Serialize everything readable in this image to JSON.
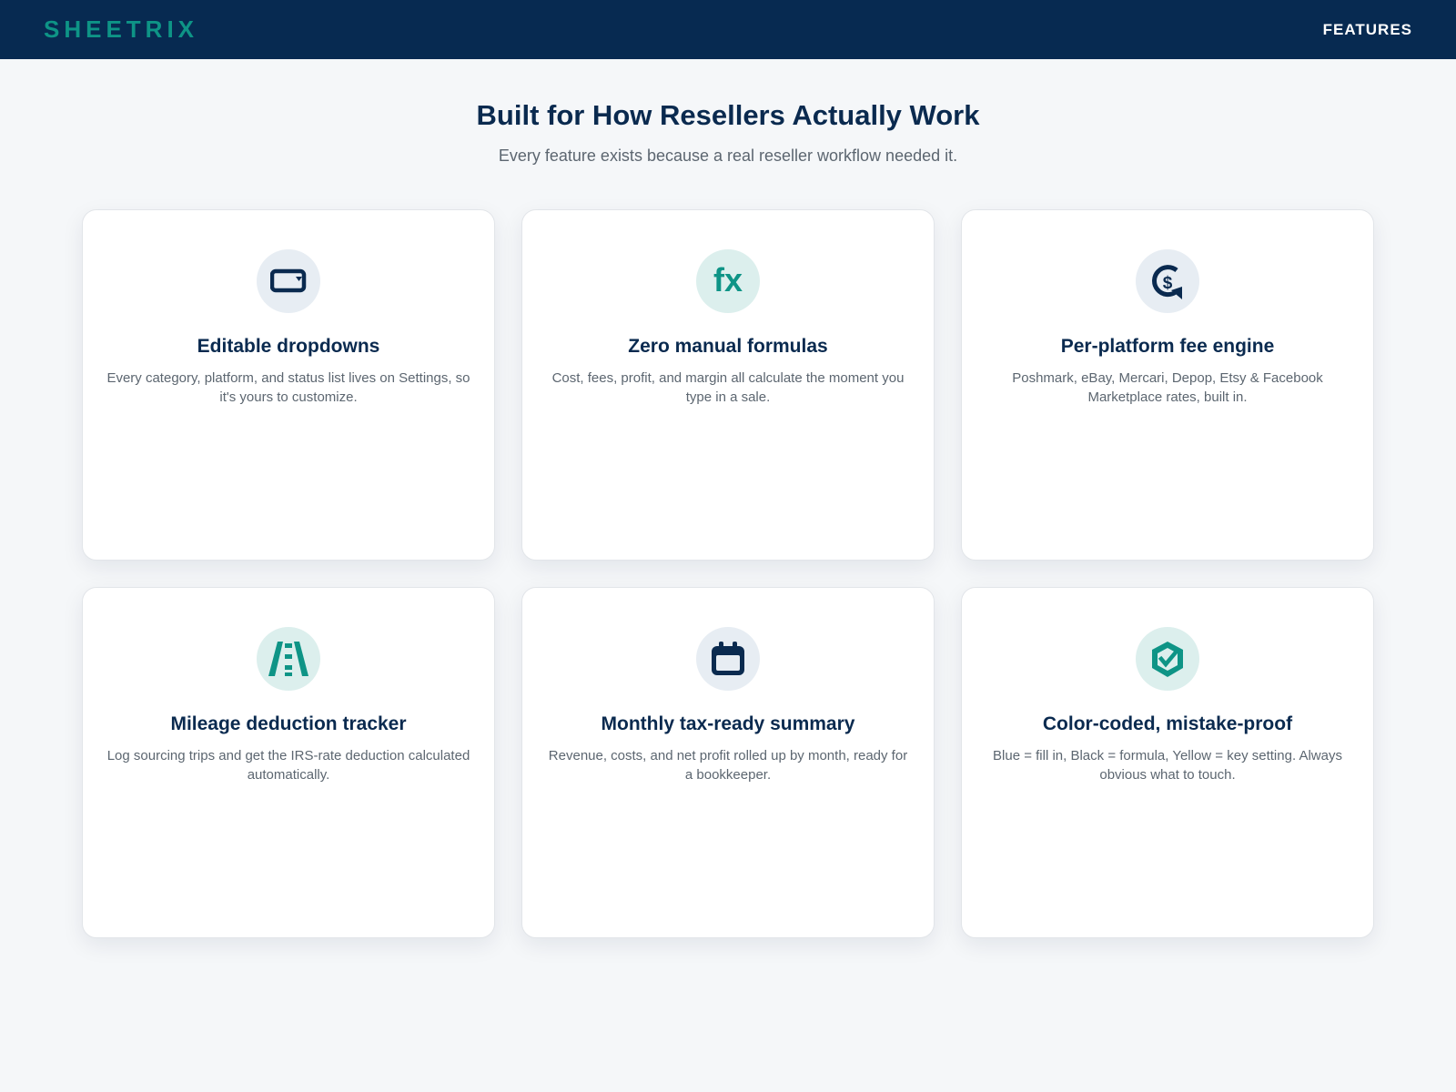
{
  "header": {
    "logo": "SHEETRIX",
    "nav_link": "FEATURES"
  },
  "hero": {
    "title": "Built for How Resellers Actually Work",
    "subtitle": "Every feature exists because a real reseller workflow needed it."
  },
  "colors": {
    "navy": "#072a51",
    "teal": "#0e9486",
    "background": "#f5f7f9"
  },
  "features": [
    {
      "icon": "dropdown-icon",
      "glyph": "",
      "title": "Editable dropdowns",
      "description": "Every category, platform, and status list lives on Settings, so it's yours to customize."
    },
    {
      "icon": "formula-icon",
      "glyph": "fx",
      "title": "Zero manual formulas",
      "description": "Cost, fees, profit, and margin all calculate the moment you type in a sale."
    },
    {
      "icon": "dollar-cycle-icon",
      "glyph": "",
      "title": "Per-platform fee engine",
      "description": "Poshmark, eBay, Mercari, Depop, Etsy & Facebook Marketplace rates, built in."
    },
    {
      "icon": "road-icon",
      "glyph": "",
      "title": "Mileage deduction tracker",
      "description": "Log sourcing trips and get the IRS-rate deduction calculated automatically."
    },
    {
      "icon": "calendar-icon",
      "glyph": "",
      "title": "Monthly tax-ready summary",
      "description": "Revenue, costs, and net profit rolled up by month, ready for a bookkeeper."
    },
    {
      "icon": "shield-check-icon",
      "glyph": "",
      "title": "Color-coded, mistake-proof",
      "description": "Blue = fill in, Black = formula, Yellow = key setting. Always obvious what to touch."
    }
  ]
}
